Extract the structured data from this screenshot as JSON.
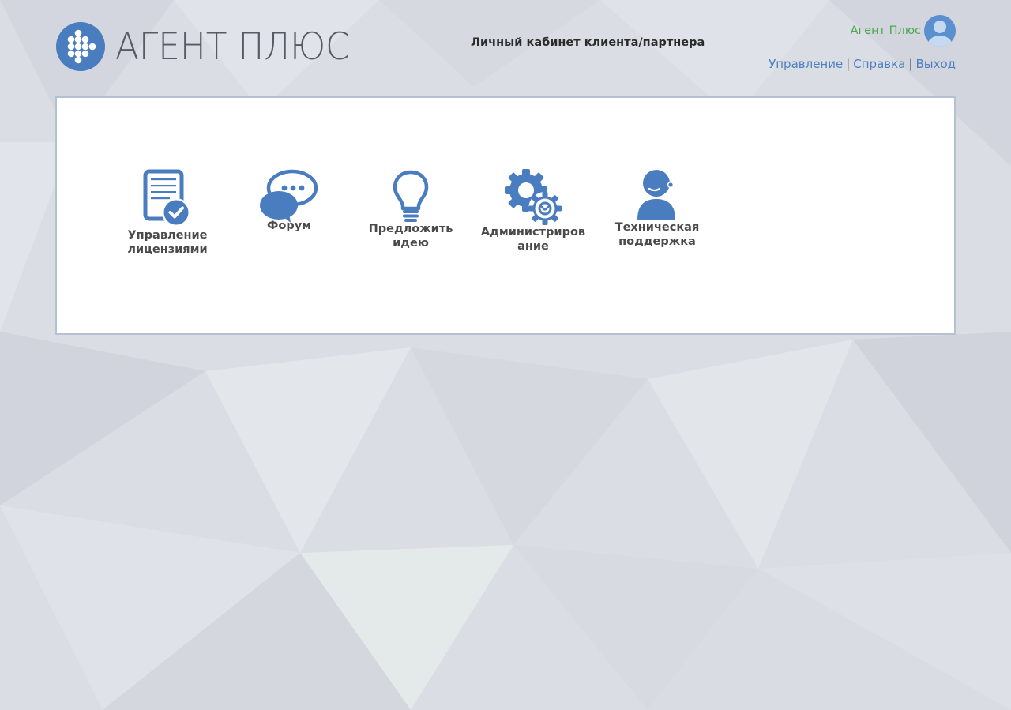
{
  "header": {
    "brand": "АГЕНТ ПЛЮС",
    "subtitle": "Личный кабинет клиента/партнера",
    "user_name": "Агент Плюс",
    "links": [
      {
        "label": "Управление"
      },
      {
        "label": "Справка"
      },
      {
        "label": "Выход"
      }
    ],
    "separator": "|"
  },
  "tiles": [
    {
      "label_lines": [
        "Управление",
        "лицензиями"
      ],
      "icon": "license-check-icon"
    },
    {
      "label_lines": [
        "Форум"
      ],
      "icon": "chat-bubbles-icon"
    },
    {
      "label_lines": [
        "Предложить",
        "идею"
      ],
      "icon": "lightbulb-icon"
    },
    {
      "label_lines": [
        "Администриров",
        "ание"
      ],
      "icon": "gears-icon"
    },
    {
      "label_lines": [
        "Техническая",
        "поддержка"
      ],
      "icon": "support-agent-icon"
    }
  ],
  "colors": {
    "accent": "#4a7cc0",
    "user_name": "#4aa84d",
    "link": "#4f7fc0",
    "brand_text": "#555b63"
  }
}
